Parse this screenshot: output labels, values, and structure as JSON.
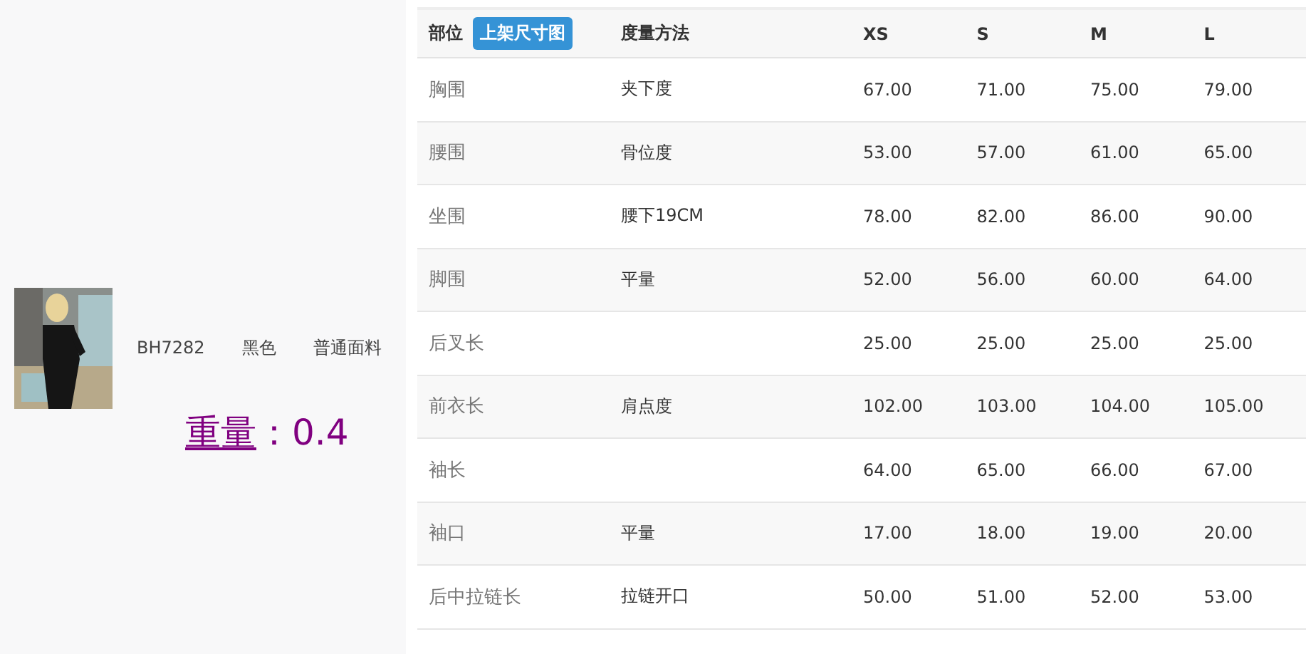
{
  "product": {
    "code": "BH7282",
    "shade": "黑色",
    "fabric": "普通面料",
    "weight_label": "重量",
    "weight_value": "：0.4"
  },
  "table": {
    "columns": [
      {
        "label": "部位",
        "badge": "上架尺寸图"
      },
      {
        "label": "度量方法"
      },
      {
        "label": "XS"
      },
      {
        "label": "S"
      },
      {
        "label": "M"
      },
      {
        "label": "L"
      }
    ],
    "rows": [
      {
        "part": "胸围",
        "method": "夹下度",
        "values": [
          "67.00",
          "71.00",
          "75.00",
          "79.00"
        ]
      },
      {
        "part": "腰围",
        "method": "骨位度",
        "values": [
          "53.00",
          "57.00",
          "61.00",
          "65.00"
        ]
      },
      {
        "part": "坐围",
        "method": "腰下19CM",
        "values": [
          "78.00",
          "82.00",
          "86.00",
          "90.00"
        ]
      },
      {
        "part": "脚围",
        "method": "平量",
        "values": [
          "52.00",
          "56.00",
          "60.00",
          "64.00"
        ]
      },
      {
        "part": "后叉长",
        "method": "",
        "values": [
          "25.00",
          "25.00",
          "25.00",
          "25.00"
        ]
      },
      {
        "part": "前衣长",
        "method": "肩点度",
        "values": [
          "102.00",
          "103.00",
          "104.00",
          "105.00"
        ]
      },
      {
        "part": "袖长",
        "method": "",
        "values": [
          "64.00",
          "65.00",
          "66.00",
          "67.00"
        ]
      },
      {
        "part": "袖口",
        "method": "平量",
        "values": [
          "17.00",
          "18.00",
          "19.00",
          "20.00"
        ]
      },
      {
        "part": "后中拉链长",
        "method": "拉链开口",
        "values": [
          "50.00",
          "51.00",
          "52.00",
          "53.00"
        ]
      }
    ]
  }
}
